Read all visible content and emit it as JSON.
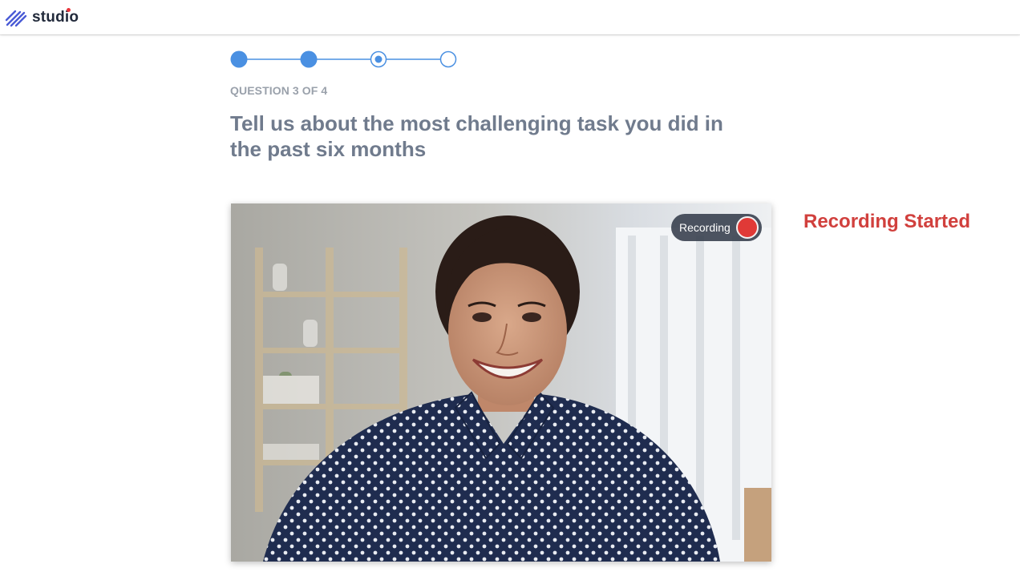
{
  "app": {
    "brand": "studio",
    "accent_color": "#4a90e2",
    "brand_dot_color": "#e8343a"
  },
  "progress": {
    "total_steps": 4,
    "current_step": 3,
    "completed_steps": 2
  },
  "question": {
    "counter": "QUESTION 3 OF 4",
    "title": "Tell us about the most challenging task you did in the past six months"
  },
  "video": {
    "recording_label": "Recording",
    "recording_dot_color": "#e03a37"
  },
  "status": {
    "text": "Recording Started",
    "color": "#d1403d"
  }
}
